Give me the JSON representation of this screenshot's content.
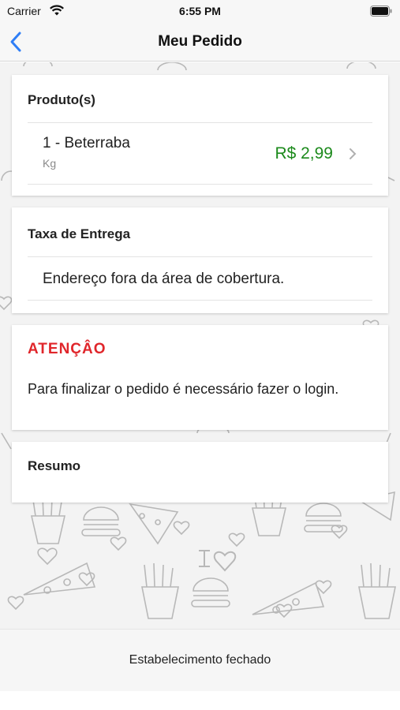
{
  "status_bar": {
    "carrier": "Carrier",
    "time": "6:55 PM"
  },
  "nav": {
    "title": "Meu Pedido"
  },
  "products": {
    "title": "Produto(s)",
    "items": [
      {
        "name": "1 - Beterraba",
        "unit": "Kg",
        "price": "R$ 2,99"
      }
    ]
  },
  "delivery": {
    "title": "Taxa de Entrega",
    "message": "Endereço fora da área de cobertura."
  },
  "attention": {
    "title": "ATENÇÂO",
    "message": "Para finalizar o pedido é necessário fazer o login."
  },
  "summary": {
    "title": "Resumo"
  },
  "footer": {
    "status": "Estabelecimento fechado"
  },
  "colors": {
    "price": "#1c8a1c",
    "attention": "#e0262b",
    "back": "#2f7ef6"
  },
  "icons": [
    "wifi-icon",
    "battery-icon",
    "back-chevron-icon",
    "chevron-right-icon"
  ]
}
